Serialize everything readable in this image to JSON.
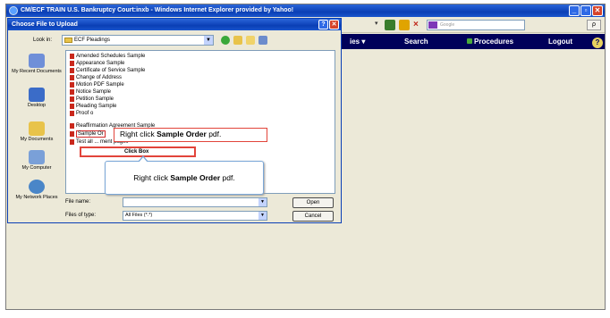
{
  "window": {
    "title": "CM/ECF TRAIN  U.S. Bankruptcy Court:inxb - Windows Internet Explorer provided by Yahoo!",
    "minimize": "_",
    "maximize": "▫",
    "close": "✕"
  },
  "ie_toolbar": {
    "search_placeholder": "Google",
    "search_button": "ρ"
  },
  "app_nav": {
    "utilities": "ies ▾",
    "search": "Search",
    "procedures": "Procedures",
    "logout": "Logout",
    "help": "?"
  },
  "dialog": {
    "title": "Choose File to Upload",
    "help_button": "?",
    "close_button": "✕",
    "lookin_label": "Look in:",
    "lookin_value": "ECF Pleadings",
    "lookin_arrow": "▼",
    "places": [
      {
        "label": "My Recent Documents"
      },
      {
        "label": "Desktop"
      },
      {
        "label": "My Documents"
      },
      {
        "label": "My Computer"
      },
      {
        "label": "My Network Places"
      }
    ],
    "files": [
      "Amended Schedules Sample",
      "Appearance Sample",
      "Certificate of Service Sample",
      "Change of Address",
      "Motion PDF Sample",
      "Notice Sample",
      "Petition Sample",
      "Pleading Sample",
      "Proof o",
      "Reaffirmation Agreement Sample",
      "Sample Or",
      "Test all ... ment pages"
    ],
    "click_box_text": "Click Box",
    "filename_label": "File name:",
    "filename_value": "",
    "filetype_label": "Files of type:",
    "filetype_value": "All Files (*.*)",
    "field_arrow": "▼",
    "open_button": "Open",
    "cancel_button": "Cancel"
  },
  "callouts": {
    "small_prefix": "Right click ",
    "small_bold": "Sample Order",
    "small_suffix": " pdf.",
    "box_prefix": "Right click ",
    "box_bold": "Sample Order",
    "box_suffix": " pdf."
  }
}
